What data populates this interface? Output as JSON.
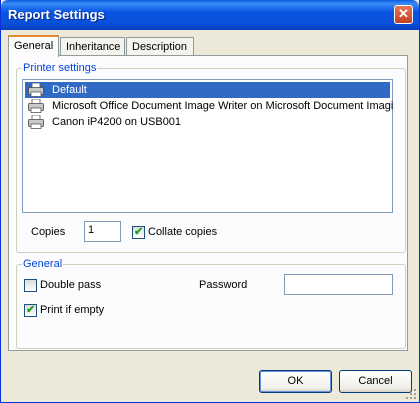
{
  "window": {
    "title": "Report Settings",
    "close_glyph": "✕"
  },
  "tabs": [
    {
      "label": "General",
      "active": true
    },
    {
      "label": "Inheritance",
      "active": false
    },
    {
      "label": "Description",
      "active": false
    }
  ],
  "printer_group": {
    "legend": "Printer settings",
    "printers": [
      {
        "name": "Default",
        "selected": true,
        "icon": "printer-icon"
      },
      {
        "name": "Microsoft Office Document Image Writer on Microsoft Document Imagi",
        "selected": false,
        "icon": "printer-icon"
      },
      {
        "name": "Canon iP4200 on USB001",
        "selected": false,
        "icon": "printer-icon"
      }
    ],
    "copies_label": "Copies",
    "copies_value": "1",
    "collate_label": "Collate copies",
    "collate_checked": true
  },
  "general_group": {
    "legend": "General",
    "double_pass_label": "Double pass",
    "double_pass_checked": false,
    "print_if_empty_label": "Print if empty",
    "print_if_empty_checked": true,
    "password_label": "Password",
    "password_value": ""
  },
  "buttons": {
    "ok": "OK",
    "cancel": "Cancel"
  },
  "colors": {
    "title_bar": "#0a4fd8",
    "selection": "#316ac5",
    "legend_text": "#0046d5",
    "active_tab_accent": "#e68b2c",
    "check_green": "#21a121"
  }
}
